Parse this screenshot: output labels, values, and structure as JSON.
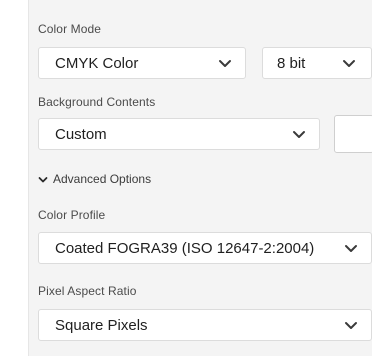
{
  "color_mode": {
    "label": "Color Mode",
    "mode_value": "CMYK Color",
    "bit_value": "8 bit"
  },
  "background_contents": {
    "label": "Background Contents",
    "value": "Custom",
    "swatch_color": "#ffffff"
  },
  "advanced": {
    "label": "Advanced Options"
  },
  "color_profile": {
    "label": "Color Profile",
    "value": "Coated FOGRA39 (ISO 12647-2:2004)"
  },
  "pixel_aspect_ratio": {
    "label": "Pixel Aspect Ratio",
    "value": "Square Pixels"
  },
  "icons": {
    "dropdown": "chevron-down-icon",
    "disclosure": "chevron-down-icon"
  }
}
